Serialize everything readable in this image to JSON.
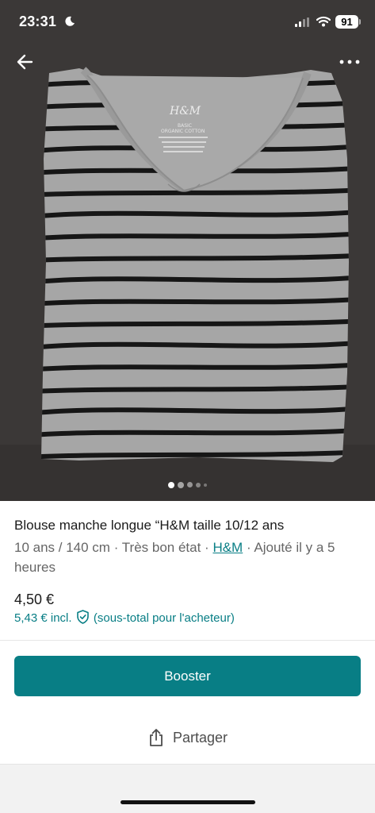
{
  "status_bar": {
    "time": "23:31",
    "battery": "91"
  },
  "gallery": {
    "image_count": 5,
    "active_index": 0,
    "label_brand": "H&M",
    "label_line1": "BASIC",
    "label_line2": "ORGANIC COTTON"
  },
  "item": {
    "title": "Blouse manche longue “H&M taille 10/12 ans",
    "size": "10 ans / 140 cm",
    "condition": "Très bon état",
    "brand": "H&M",
    "added": "Ajouté il y a 5 heures",
    "separator": " · ",
    "price": "4,50 €",
    "price_incl": "5,43 € incl.",
    "protection_note": "(sous-total pour l'acheteur)"
  },
  "actions": {
    "booster_label": "Booster",
    "share_label": "Partager"
  },
  "colors": {
    "accent": "#087e85",
    "text": "#1a1a1a",
    "muted": "#666666",
    "photo_bg": "#3b3837"
  },
  "icons": [
    "back-arrow-icon",
    "more-options-icon",
    "shield-check-icon",
    "share-icon",
    "moon-icon",
    "signal-icon",
    "wifi-icon",
    "battery-icon"
  ]
}
